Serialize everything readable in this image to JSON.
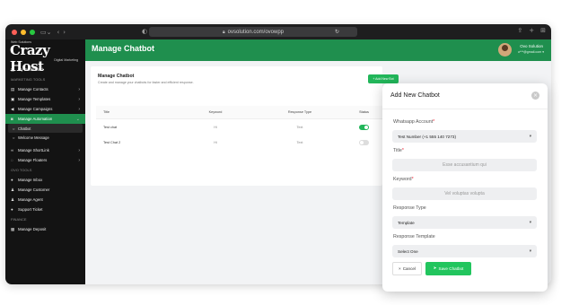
{
  "browser": {
    "url": "ovsolution.com/ovowpp",
    "colors": {
      "close": "#ff5f57",
      "minimize": "#febc2e",
      "zoom": "#28c840"
    }
  },
  "logo": {
    "top": "Web Solutions",
    "name": "Crazy Host",
    "tagline": "Digital Marketing"
  },
  "sidebar": {
    "dashboard": "My Dashboard",
    "marketing_section": "MARKETING TOOLS",
    "items": [
      {
        "label": "Manage Contacts"
      },
      {
        "label": "Manage Templates"
      },
      {
        "label": "Manage Campaigns"
      },
      {
        "label": "Manage Automation"
      }
    ],
    "sub_items": [
      {
        "label": "Chatbot"
      },
      {
        "label": "Welcome Message"
      }
    ],
    "more_items": [
      {
        "label": "Manage ShortLink"
      },
      {
        "label": "Manage Floaters"
      }
    ],
    "ovo_section": "OVO TOOLS",
    "ovo_items": [
      {
        "label": "Manage Inbox"
      },
      {
        "label": "Manage Customer"
      },
      {
        "label": "Manage Agent"
      },
      {
        "label": "Support Ticket"
      }
    ],
    "finance_section": "FINANCE",
    "finance_items": [
      {
        "label": "Manage Deposit"
      }
    ]
  },
  "header": {
    "title": "Manage Chatbot",
    "user_name": "Ovo Solution",
    "user_email": "o***@gmail.com"
  },
  "page": {
    "card_title": "Manage Chatbot",
    "card_desc": "Create and manage your chatbots for faster and efficient response.",
    "add_button": "+ Add New Bot"
  },
  "table": {
    "headers": {
      "title": "Title",
      "keyword": "Keyword",
      "response_type": "Response Type",
      "status": "Status"
    },
    "rows": [
      {
        "title": "Test chat",
        "keyword": "Hi",
        "response_type": "Text",
        "status_on": true
      },
      {
        "title": "Test Chat 2",
        "keyword": "Hi",
        "response_type": "Text",
        "status_on": false
      }
    ]
  },
  "modal": {
    "title": "Add New Chatbot",
    "whatsapp_label": "Whatsapp Account",
    "whatsapp_value": "Test Number (+1 555 140 7273)",
    "title_label": "Title",
    "title_placeholder": "Esse accusantium qui",
    "keyword_label": "Keyword",
    "keyword_placeholder": "Vel voluptas volupta",
    "response_type_label": "Response Type",
    "response_type_value": "Template",
    "response_template_label": "Response Template",
    "response_template_value": "Select One",
    "cancel": "Cancel",
    "save": "Save Chatbot",
    "required_mark": "*"
  }
}
